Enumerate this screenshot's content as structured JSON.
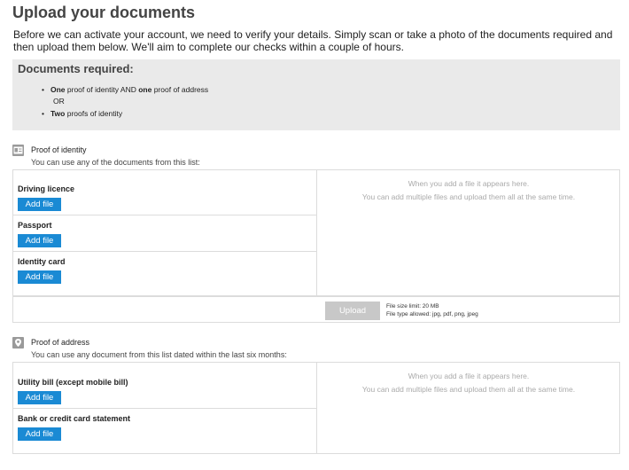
{
  "page": {
    "title": "Upload your documents",
    "intro": "Before we can activate your account, we need to verify your details. Simply scan or take a photo of the documents required and then upload them below. We'll aim to complete our checks within a couple of hours."
  },
  "requirements": {
    "title": "Documents required:",
    "option1_bold1": "One",
    "option1_text1": " proof of identity AND ",
    "option1_bold2": "one",
    "option1_text2": " proof of address",
    "or_text": "OR",
    "option2_bold": "Two",
    "option2_text": " proofs of identity"
  },
  "identity": {
    "icon": "id-card-icon",
    "title": "Proof of identity",
    "subtitle": "You can use any of the documents from this list:",
    "documents": [
      {
        "label": "Driving licence",
        "button": "Add file"
      },
      {
        "label": "Passport",
        "button": "Add file"
      },
      {
        "label": "Identity card",
        "button": "Add file"
      }
    ],
    "hint_line1": "When you add a file it appears here.",
    "hint_line2": "You can add multiple files and upload them all at the same time."
  },
  "upload": {
    "button": "Upload",
    "size_limit": "File size limit: 20 MB",
    "types": "File type allowed: jpg, pdf, png, jpeg"
  },
  "address": {
    "icon": "location-pin-icon",
    "title": "Proof of address",
    "subtitle": "You can use any document from this list dated within the last six months:",
    "documents": [
      {
        "label": "Utility bill (except mobile bill)",
        "button": "Add file"
      },
      {
        "label": "Bank or credit card statement",
        "button": "Add file"
      }
    ],
    "hint_line1": "When you add a file it appears here.",
    "hint_line2": "You can add multiple files and upload them all at the same time."
  },
  "colors": {
    "accent": "#1a8ad4",
    "disabled": "#c8c8c8",
    "panel_bg": "#eaeaea"
  }
}
